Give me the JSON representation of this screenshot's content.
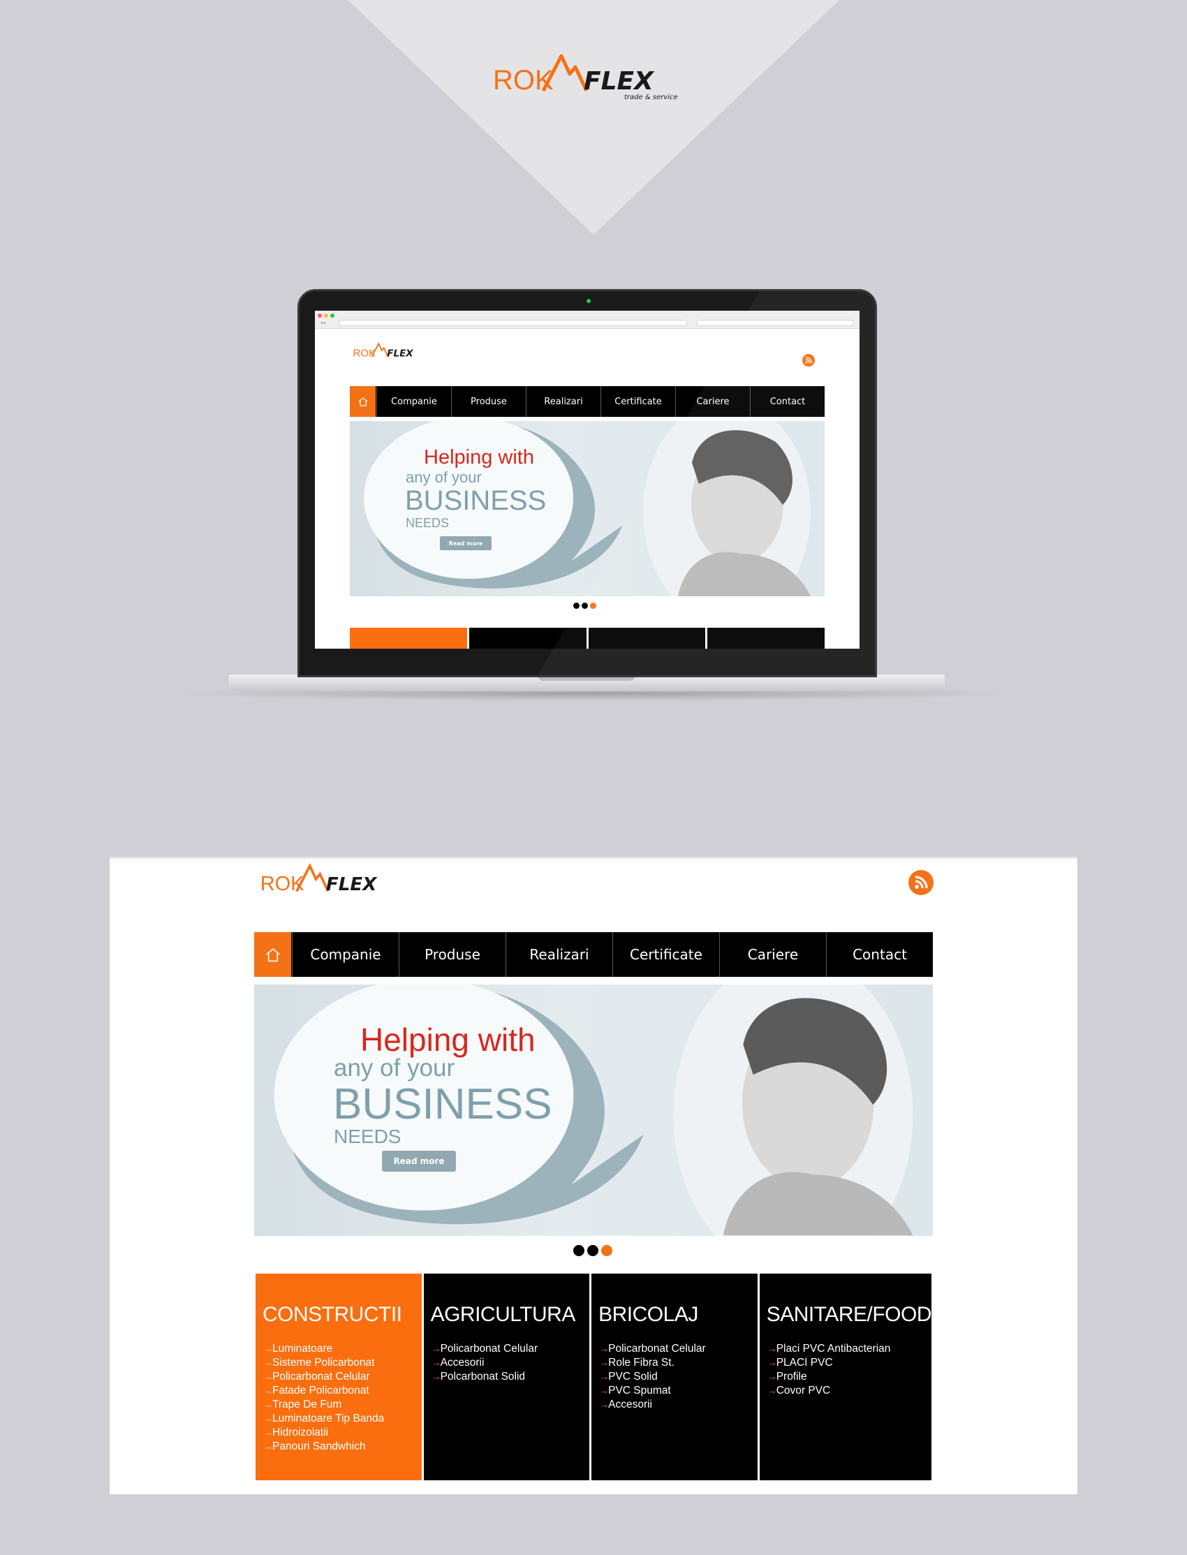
{
  "brand": {
    "rok": "ROK",
    "flex": "FLEX",
    "tagline": "trade & service"
  },
  "nav": {
    "home_icon": "home-icon",
    "items": [
      {
        "label": "Companie"
      },
      {
        "label": "Produse"
      },
      {
        "label": "Realizari"
      },
      {
        "label": "Certificate"
      },
      {
        "label": "Cariere"
      },
      {
        "label": "Contact"
      }
    ]
  },
  "rss_icon": "rss-icon",
  "banner": {
    "line1": "Helping with",
    "line2": "any of your",
    "line3": "BUSINESS",
    "line4": "NEEDS",
    "button_label": "Read more",
    "slides_total": 3,
    "active_slide": 3
  },
  "categories": [
    {
      "title": "CONSTRUCTII",
      "items": [
        "Luminatoare",
        "Sisteme Policarbonat",
        "Policarbonat Celular",
        "Fatade Policarbonat",
        "Trape De Fum",
        "Luminatoare Tip Banda",
        "Hidroizolatii",
        "Panouri Sandwhich"
      ]
    },
    {
      "title": "AGRICULTURA",
      "items": [
        "Policarbonat Celular",
        "Accesorii",
        "Polcarbonat Solid"
      ]
    },
    {
      "title": "BRICOLAJ",
      "items": [
        "Policarbonat Celular",
        "Role Fibra St.",
        "PVC Solid",
        "PVC Spumat",
        "Accesorii"
      ]
    },
    {
      "title": "SANITARE/FOOD",
      "items": [
        "Placi PVC Antibacterian",
        "PLACI PVC",
        "Profile",
        "Covor PVC"
      ]
    }
  ],
  "colors": {
    "background": "#cfcfd5",
    "accent": "#f47216",
    "nav_bg": "#000000",
    "banner_text_red": "#d9261c",
    "banner_text_blue": "#7f9fab"
  }
}
